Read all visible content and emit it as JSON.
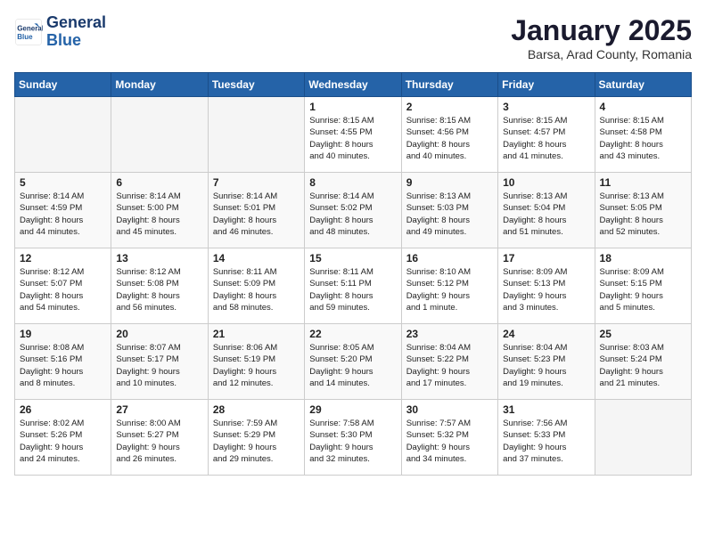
{
  "header": {
    "logo_line1": "General",
    "logo_line2": "Blue",
    "month": "January 2025",
    "location": "Barsa, Arad County, Romania"
  },
  "weekdays": [
    "Sunday",
    "Monday",
    "Tuesday",
    "Wednesday",
    "Thursday",
    "Friday",
    "Saturday"
  ],
  "weeks": [
    [
      {
        "day": "",
        "info": ""
      },
      {
        "day": "",
        "info": ""
      },
      {
        "day": "",
        "info": ""
      },
      {
        "day": "1",
        "info": "Sunrise: 8:15 AM\nSunset: 4:55 PM\nDaylight: 8 hours\nand 40 minutes."
      },
      {
        "day": "2",
        "info": "Sunrise: 8:15 AM\nSunset: 4:56 PM\nDaylight: 8 hours\nand 40 minutes."
      },
      {
        "day": "3",
        "info": "Sunrise: 8:15 AM\nSunset: 4:57 PM\nDaylight: 8 hours\nand 41 minutes."
      },
      {
        "day": "4",
        "info": "Sunrise: 8:15 AM\nSunset: 4:58 PM\nDaylight: 8 hours\nand 43 minutes."
      }
    ],
    [
      {
        "day": "5",
        "info": "Sunrise: 8:14 AM\nSunset: 4:59 PM\nDaylight: 8 hours\nand 44 minutes."
      },
      {
        "day": "6",
        "info": "Sunrise: 8:14 AM\nSunset: 5:00 PM\nDaylight: 8 hours\nand 45 minutes."
      },
      {
        "day": "7",
        "info": "Sunrise: 8:14 AM\nSunset: 5:01 PM\nDaylight: 8 hours\nand 46 minutes."
      },
      {
        "day": "8",
        "info": "Sunrise: 8:14 AM\nSunset: 5:02 PM\nDaylight: 8 hours\nand 48 minutes."
      },
      {
        "day": "9",
        "info": "Sunrise: 8:13 AM\nSunset: 5:03 PM\nDaylight: 8 hours\nand 49 minutes."
      },
      {
        "day": "10",
        "info": "Sunrise: 8:13 AM\nSunset: 5:04 PM\nDaylight: 8 hours\nand 51 minutes."
      },
      {
        "day": "11",
        "info": "Sunrise: 8:13 AM\nSunset: 5:05 PM\nDaylight: 8 hours\nand 52 minutes."
      }
    ],
    [
      {
        "day": "12",
        "info": "Sunrise: 8:12 AM\nSunset: 5:07 PM\nDaylight: 8 hours\nand 54 minutes."
      },
      {
        "day": "13",
        "info": "Sunrise: 8:12 AM\nSunset: 5:08 PM\nDaylight: 8 hours\nand 56 minutes."
      },
      {
        "day": "14",
        "info": "Sunrise: 8:11 AM\nSunset: 5:09 PM\nDaylight: 8 hours\nand 58 minutes."
      },
      {
        "day": "15",
        "info": "Sunrise: 8:11 AM\nSunset: 5:11 PM\nDaylight: 8 hours\nand 59 minutes."
      },
      {
        "day": "16",
        "info": "Sunrise: 8:10 AM\nSunset: 5:12 PM\nDaylight: 9 hours\nand 1 minute."
      },
      {
        "day": "17",
        "info": "Sunrise: 8:09 AM\nSunset: 5:13 PM\nDaylight: 9 hours\nand 3 minutes."
      },
      {
        "day": "18",
        "info": "Sunrise: 8:09 AM\nSunset: 5:15 PM\nDaylight: 9 hours\nand 5 minutes."
      }
    ],
    [
      {
        "day": "19",
        "info": "Sunrise: 8:08 AM\nSunset: 5:16 PM\nDaylight: 9 hours\nand 8 minutes."
      },
      {
        "day": "20",
        "info": "Sunrise: 8:07 AM\nSunset: 5:17 PM\nDaylight: 9 hours\nand 10 minutes."
      },
      {
        "day": "21",
        "info": "Sunrise: 8:06 AM\nSunset: 5:19 PM\nDaylight: 9 hours\nand 12 minutes."
      },
      {
        "day": "22",
        "info": "Sunrise: 8:05 AM\nSunset: 5:20 PM\nDaylight: 9 hours\nand 14 minutes."
      },
      {
        "day": "23",
        "info": "Sunrise: 8:04 AM\nSunset: 5:22 PM\nDaylight: 9 hours\nand 17 minutes."
      },
      {
        "day": "24",
        "info": "Sunrise: 8:04 AM\nSunset: 5:23 PM\nDaylight: 9 hours\nand 19 minutes."
      },
      {
        "day": "25",
        "info": "Sunrise: 8:03 AM\nSunset: 5:24 PM\nDaylight: 9 hours\nand 21 minutes."
      }
    ],
    [
      {
        "day": "26",
        "info": "Sunrise: 8:02 AM\nSunset: 5:26 PM\nDaylight: 9 hours\nand 24 minutes."
      },
      {
        "day": "27",
        "info": "Sunrise: 8:00 AM\nSunset: 5:27 PM\nDaylight: 9 hours\nand 26 minutes."
      },
      {
        "day": "28",
        "info": "Sunrise: 7:59 AM\nSunset: 5:29 PM\nDaylight: 9 hours\nand 29 minutes."
      },
      {
        "day": "29",
        "info": "Sunrise: 7:58 AM\nSunset: 5:30 PM\nDaylight: 9 hours\nand 32 minutes."
      },
      {
        "day": "30",
        "info": "Sunrise: 7:57 AM\nSunset: 5:32 PM\nDaylight: 9 hours\nand 34 minutes."
      },
      {
        "day": "31",
        "info": "Sunrise: 7:56 AM\nSunset: 5:33 PM\nDaylight: 9 hours\nand 37 minutes."
      },
      {
        "day": "",
        "info": ""
      }
    ]
  ]
}
